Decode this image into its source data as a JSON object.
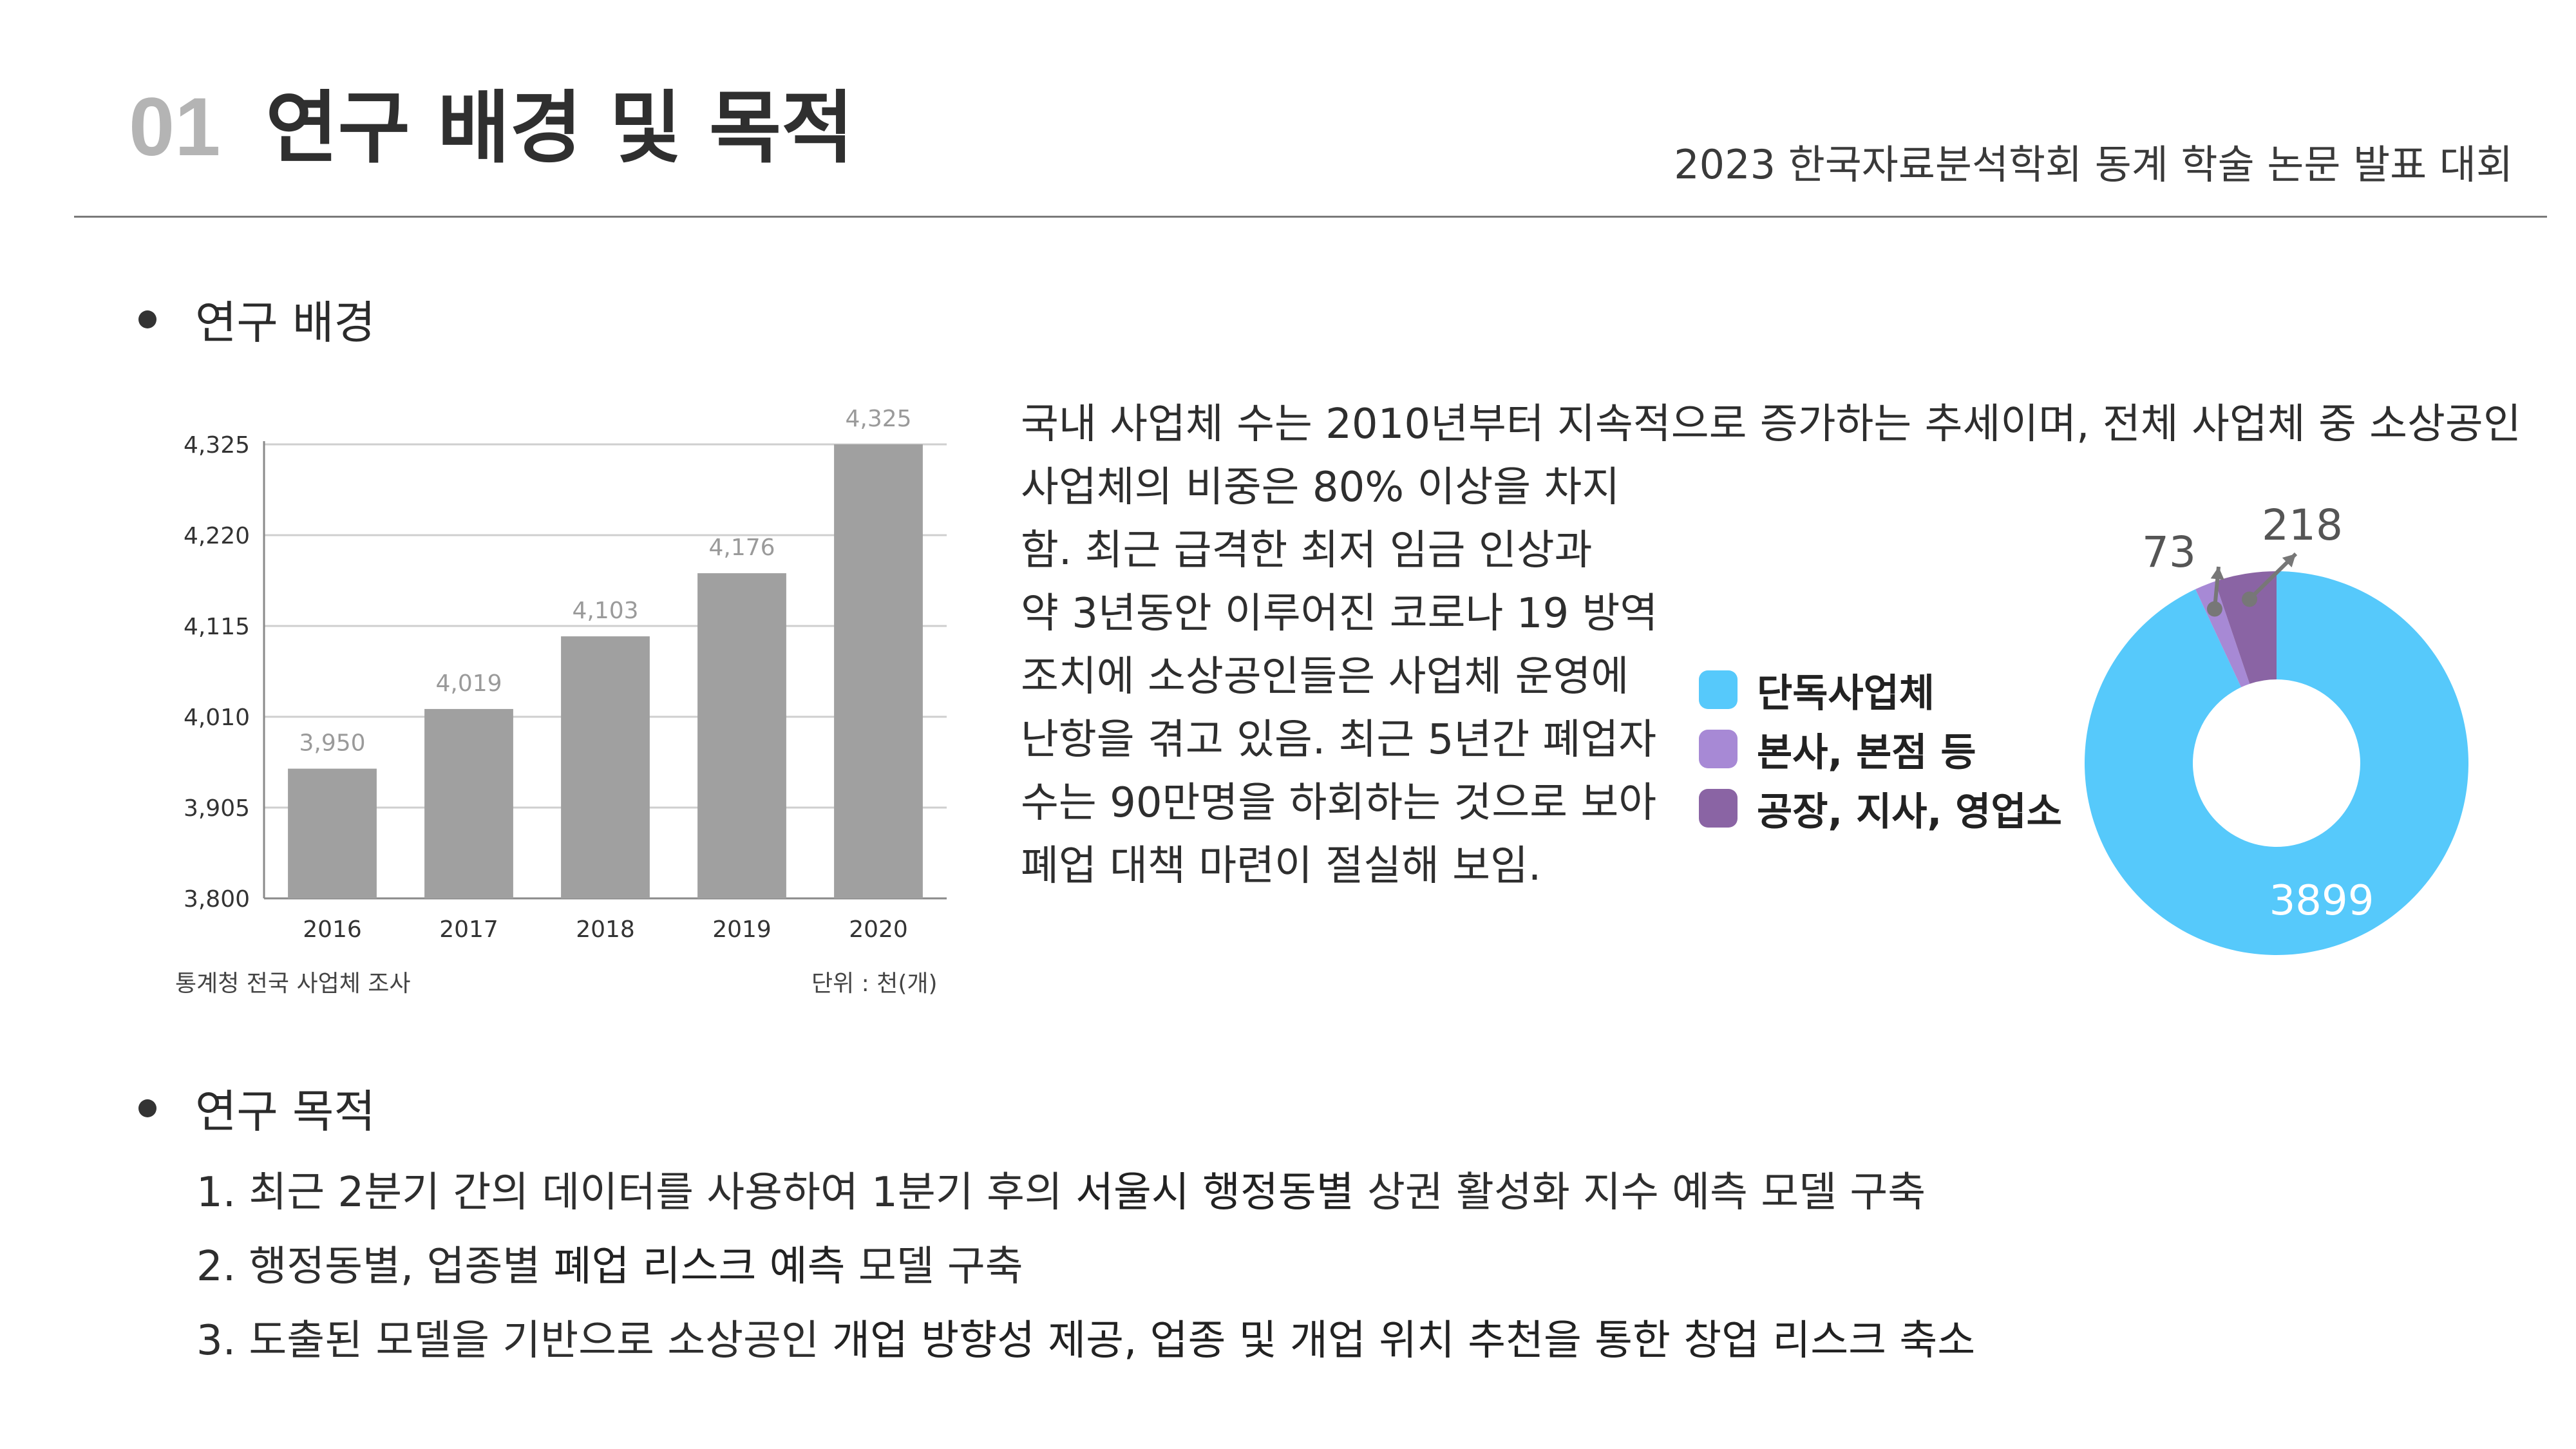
{
  "header": {
    "number": "01",
    "title": "연구 배경 및 목적",
    "conference": "2023 한국자료분석학회 동계 학술 논문 발표 대회"
  },
  "sections": {
    "background": "연구 배경",
    "purpose": "연구 목적"
  },
  "chart_data": [
    {
      "type": "bar",
      "categories": [
        "2016",
        "2017",
        "2018",
        "2019",
        "2020"
      ],
      "values": [
        3950,
        4019,
        4103,
        4176,
        4325
      ],
      "value_labels": [
        "3,950",
        "4,019",
        "4,103",
        "4,176",
        "4,325"
      ],
      "yticks": [
        "3,800",
        "3,905",
        "4,010",
        "4,115",
        "4,220",
        "4,325"
      ],
      "ylim": [
        3800,
        4325
      ],
      "source": "통계청 전국 사업체 조사",
      "unit": "단위 : 천(개)",
      "bar_color": "#a0a0a0",
      "grid": true
    },
    {
      "type": "pie",
      "donut": true,
      "categories": [
        "단독사업체",
        "본사, 본점 등",
        "공장, 지사, 영업소"
      ],
      "values": [
        3899,
        73,
        218
      ],
      "value_labels": [
        "3899",
        "73",
        "218"
      ],
      "colors": [
        "#56c9fb",
        "#a789d5",
        "#8a64a4"
      ],
      "legend_position": "left"
    }
  ],
  "paragraph": [
    "국내 사업체 수는 2010년부터 지속적으로 증가하는 추세이며, 전체 사업체 중 소상공인",
    "사업체의 비중은 80% 이상을 차지",
    "함. 최근 급격한 최저 임금 인상과",
    "약 3년동안 이루어진 코로나 19 방역",
    "조치에 소상공인들은 사업체 운영에",
    "난항을 겪고 있음.  최근 5년간 폐업자",
    "수는 90만명을 하회하는 것으로 보아",
    "폐업 대책 마련이 절실해 보임."
  ],
  "goals": [
    {
      "num": "1.",
      "pre": "최근  2분기  간의  데이터를  사용하여  1분기  후의 ",
      "bold": "서울시 행정동별",
      "post": " 상권 활성화 지수 예측 모델 구축"
    },
    {
      "num": "2.",
      "pre": "행정동별, 업종별 ",
      "bold": "폐업 리스크 예측",
      "post": " 모델 구축"
    },
    {
      "num": "3.",
      "pre": "도출된 모델을 기반으로 소상공인 ",
      "bold": "개업 방향성 제공, 업종 및 개업 위치 추천을 통한 창업 리스크 축소",
      "post": ""
    }
  ]
}
